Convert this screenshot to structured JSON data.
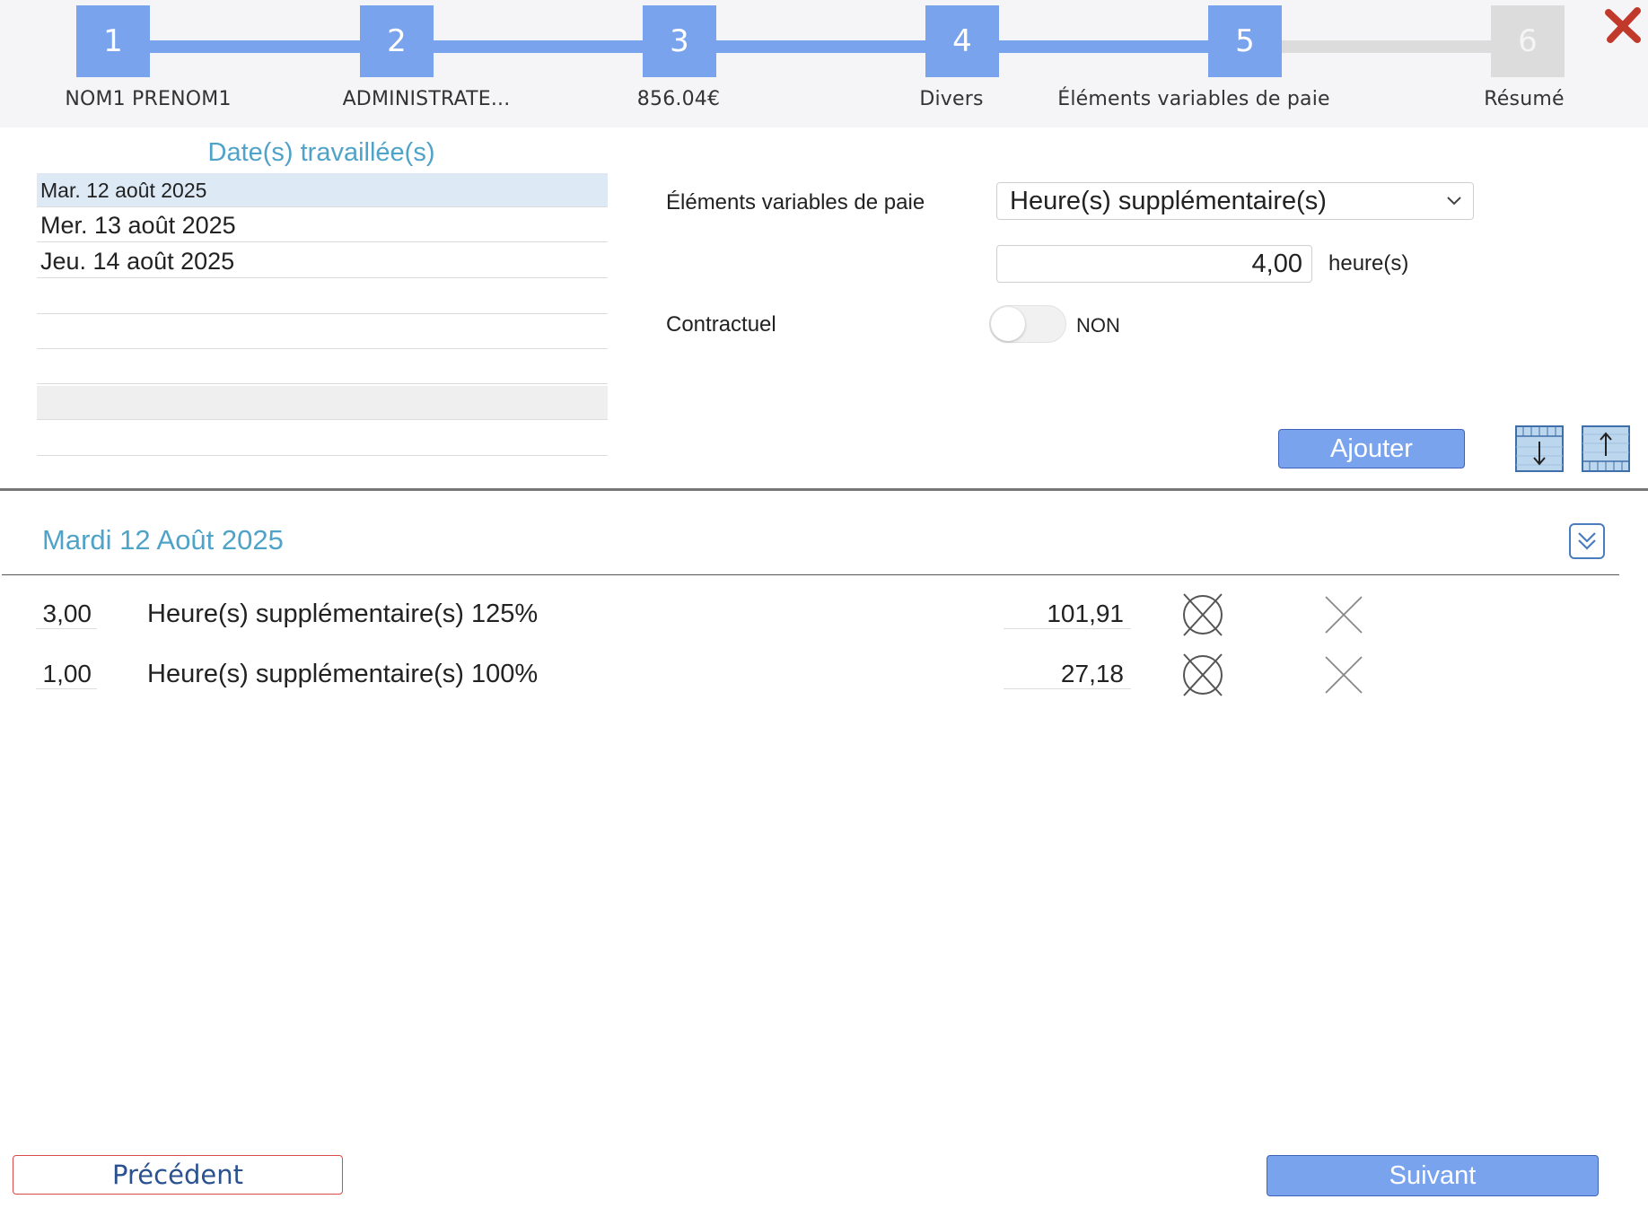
{
  "stepper": {
    "steps": [
      {
        "number": "1",
        "label": "NOM1 PRENOM1",
        "state": "done"
      },
      {
        "number": "2",
        "label": "ADMINISTRATE...",
        "state": "done"
      },
      {
        "number": "3",
        "label": "856.04€",
        "state": "done"
      },
      {
        "number": "4",
        "label": "Divers",
        "state": "done"
      },
      {
        "number": "5",
        "label": "Éléments variables de paie",
        "state": "current"
      },
      {
        "number": "6",
        "label": "Résumé",
        "state": "pending"
      }
    ],
    "close_icon": "close-x-icon",
    "active_color": "#7aa3ee",
    "inactive_color": "#dcdcdc"
  },
  "dates": {
    "title": "Date(s) travaillée(s)",
    "items": [
      "Mar. 12 août 2025",
      "Mer. 13 août 2025",
      "Jeu. 14 août 2025"
    ],
    "selected_index": 0
  },
  "form": {
    "element_label": "Éléments variables de paie",
    "element_value": "Heure(s) supplémentaire(s)",
    "quantity_value": "4,00",
    "quantity_unit": "heure(s)",
    "contractuel_label": "Contractuel",
    "contractuel_value": "NON",
    "add_button": "Ajouter"
  },
  "day": {
    "title": "Mardi 12 Août 2025",
    "rows": [
      {
        "qty": "3,00",
        "desc": "Heure(s) supplémentaire(s) 125%",
        "amount": "101,91"
      },
      {
        "qty": "1,00",
        "desc": "Heure(s) supplémentaire(s) 100%",
        "amount": "27,18"
      }
    ]
  },
  "footer": {
    "prev_button": "Précédent",
    "next_button": "Suivant"
  },
  "colors": {
    "accent": "#7aa3ee",
    "title_blue": "#4fa3c8",
    "close_red": "#c0392b",
    "prev_border": "#d94a4a"
  }
}
